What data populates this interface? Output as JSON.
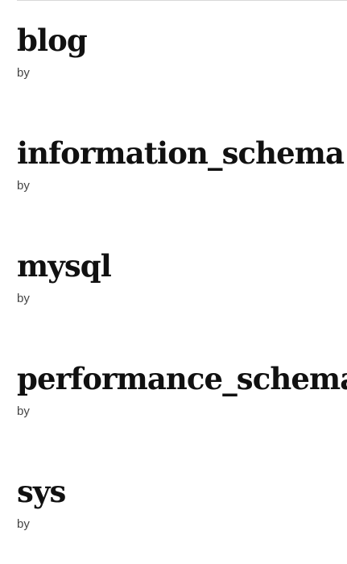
{
  "posts": [
    {
      "title": "blog",
      "byline_prefix": "by",
      "author": ""
    },
    {
      "title": "information_schema",
      "byline_prefix": "by",
      "author": ""
    },
    {
      "title": "mysql",
      "byline_prefix": "by",
      "author": ""
    },
    {
      "title": "performance_schema",
      "byline_prefix": "by",
      "author": ""
    },
    {
      "title": "sys",
      "byline_prefix": "by",
      "author": ""
    }
  ]
}
